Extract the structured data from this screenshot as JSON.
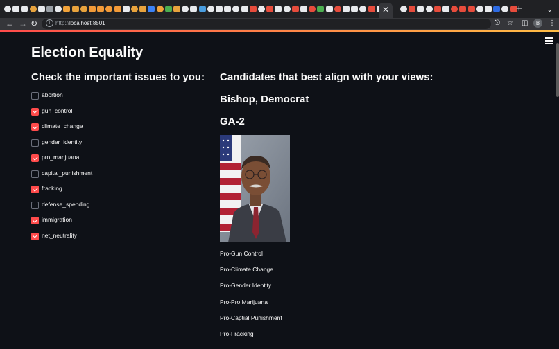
{
  "browser": {
    "url_prefix": "http://",
    "url_host": "localhost:8501",
    "profile_initial": "B",
    "active_tab_close": "✕",
    "new_tab": "+",
    "tab_menu": "⌄",
    "tab_favicon_colors": [
      "#e8eaed",
      "#e8eaed",
      "#e8eaed",
      "#e8a33d",
      "#e8eaed",
      "#9aa0a6",
      "#e8eaed",
      "#f2a33a",
      "#e8a33d",
      "#e8a33d",
      "#f29a38",
      "#f29a38",
      "#f29a38",
      "#f29a38",
      "#e8eaed",
      "#e8a33d",
      "#e8a33d",
      "#3b82f6",
      "#f2a33a",
      "#4caf50",
      "#e8a33d",
      "#e8eaed",
      "#e8eaed",
      "#4a9ee0",
      "#e8eaed",
      "#e8eaed",
      "#e8eaed",
      "#e8eaed",
      "#e8eaed",
      "#e74c3c",
      "#e8eaed",
      "#e74c3c",
      "#e8eaed",
      "#e8eaed",
      "#e74c3c",
      "#e8eaed",
      "#e74c3c",
      "#4caf50",
      "#e8eaed",
      "#e74c3c",
      "#e8eaed",
      "#e8eaed",
      "#e8eaed",
      "#e74c3c",
      "#e8eaed",
      "#e8eaed",
      "#e74c3c",
      "#e8eaed",
      "#e8eaed",
      "#e74c3c",
      "#e8eaed",
      "#e74c3c",
      "#e74c3c",
      "#e74c3c",
      "#e8eaed",
      "#e8eaed",
      "#2d6be4",
      "#e8eaed",
      "#e74c3c",
      "#e74c3c",
      "#e8eaed",
      "#e8eaed",
      "#e8eaed",
      "#3b82f6"
    ]
  },
  "app": {
    "title": "Election Equality",
    "issues_heading": "Check the important issues to you:",
    "issues": [
      {
        "label": "abortion",
        "checked": false
      },
      {
        "label": "gun_control",
        "checked": true
      },
      {
        "label": "climate_change",
        "checked": true
      },
      {
        "label": "gender_identity",
        "checked": false
      },
      {
        "label": "pro_marijuana",
        "checked": true
      },
      {
        "label": "capital_punishment",
        "checked": false
      },
      {
        "label": "fracking",
        "checked": true
      },
      {
        "label": "defense_spending",
        "checked": false
      },
      {
        "label": "immigration",
        "checked": true
      },
      {
        "label": "net_neutrality",
        "checked": true
      }
    ],
    "candidates_heading": "Candidates that best align with your views:",
    "candidate_name": "Bishop, Democrat",
    "district": "GA-2",
    "stances": [
      "Pro-Gun Control",
      "Pro-Climate Change",
      "Pro-Gender Identity",
      "Pro-Pro Marijuana",
      "Pro-Captial Punishment",
      "Pro-Fracking"
    ],
    "accent_color": "#ff4b4b"
  }
}
